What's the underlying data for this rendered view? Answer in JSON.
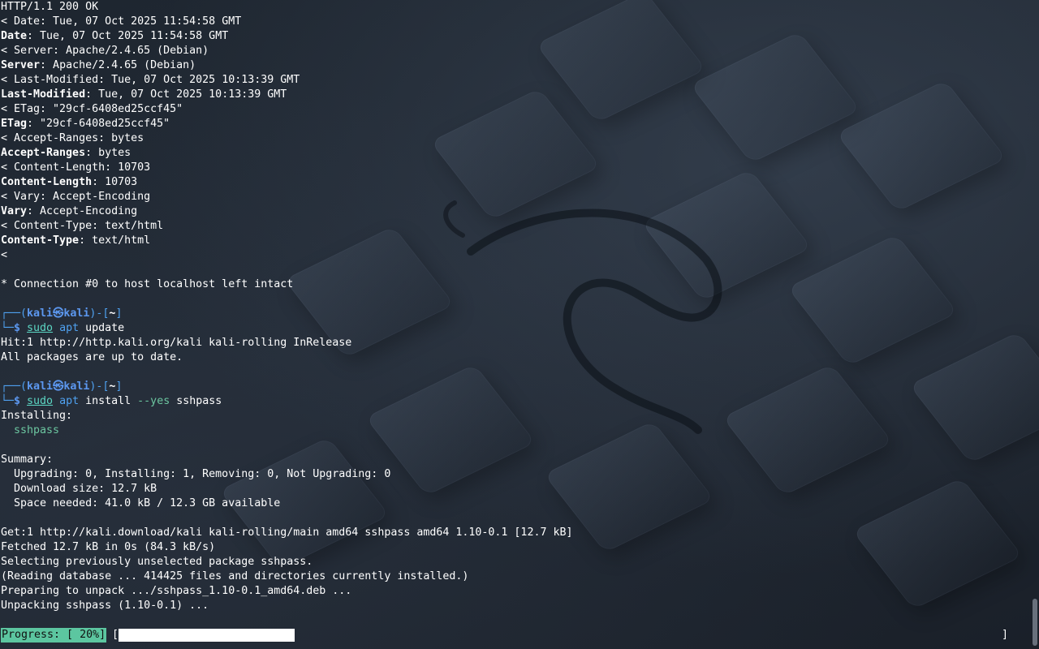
{
  "terminal": {
    "http_header_lines": [
      {
        "prefix": "",
        "key": "",
        "text": "HTTP/1.1 200 OK"
      },
      {
        "prefix": "< ",
        "key": "",
        "text": "Date: Tue, 07 Oct 2025 11:54:58 GMT"
      },
      {
        "prefix": "",
        "key": "Date",
        "text": ": Tue, 07 Oct 2025 11:54:58 GMT"
      },
      {
        "prefix": "< ",
        "key": "",
        "text": "Server: Apache/2.4.65 (Debian)"
      },
      {
        "prefix": "",
        "key": "Server",
        "text": ": Apache/2.4.65 (Debian)"
      },
      {
        "prefix": "< ",
        "key": "",
        "text": "Last-Modified: Tue, 07 Oct 2025 10:13:39 GMT"
      },
      {
        "prefix": "",
        "key": "Last-Modified",
        "text": ": Tue, 07 Oct 2025 10:13:39 GMT"
      },
      {
        "prefix": "< ",
        "key": "",
        "text": "ETag: \"29cf-6408ed25ccf45\""
      },
      {
        "prefix": "",
        "key": "ETag",
        "text": ": \"29cf-6408ed25ccf45\""
      },
      {
        "prefix": "< ",
        "key": "",
        "text": "Accept-Ranges: bytes"
      },
      {
        "prefix": "",
        "key": "Accept-Ranges",
        "text": ": bytes"
      },
      {
        "prefix": "< ",
        "key": "",
        "text": "Content-Length: 10703"
      },
      {
        "prefix": "",
        "key": "Content-Length",
        "text": ": 10703"
      },
      {
        "prefix": "< ",
        "key": "",
        "text": "Vary: Accept-Encoding"
      },
      {
        "prefix": "",
        "key": "Vary",
        "text": ": Accept-Encoding"
      },
      {
        "prefix": "< ",
        "key": "",
        "text": "Content-Type: text/html"
      },
      {
        "prefix": "",
        "key": "Content-Type",
        "text": ": text/html"
      },
      {
        "prefix": "<",
        "key": "",
        "text": ""
      },
      {
        "prefix": "",
        "key": "",
        "text": ""
      },
      {
        "prefix": "",
        "key": "",
        "text": "* Connection #0 to host localhost left intact"
      }
    ],
    "prompt": {
      "top_open": "┌──(",
      "user": "kali",
      "at": "㉿",
      "host": "kali",
      "mid": ")-[",
      "dir": "~",
      "close": "]",
      "bottom": "└─",
      "dollar": "$ "
    },
    "cmd1": {
      "sudo": "sudo",
      "apt": "apt",
      "args": " update"
    },
    "cmd1_output": [
      "Hit:1 http://http.kali.org/kali kali-rolling InRelease",
      "All packages are up to date."
    ],
    "cmd2": {
      "sudo": "sudo",
      "apt": "apt",
      "args_pre": " install ",
      "flag": "--yes",
      "args_post": " sshpass"
    },
    "install_output": {
      "installing_label": "Installing:",
      "package": "  sshpass",
      "summary_label": "Summary:",
      "summary_lines": [
        "  Upgrading: 0, Installing: 1, Removing: 0, Not Upgrading: 0",
        "  Download size: 12.7 kB",
        "  Space needed: 41.0 kB / 12.3 GB available"
      ],
      "progress_lines": [
        "Get:1 http://kali.download/kali kali-rolling/main amd64 sshpass amd64 1.10-0.1 [12.7 kB]",
        "Fetched 12.7 kB in 0s (84.3 kB/s)",
        "Selecting previously unselected package sshpass.",
        "(Reading database ... 414425 files and directories currently installed.)",
        "Preparing to unpack .../sshpass_1.10-0.1_amd64.deb ...",
        "Unpacking sshpass (1.10-0.1) ..."
      ]
    },
    "progress": {
      "label": "Progress: [ 20%]",
      "open_bracket": "[",
      "close_bracket": "]",
      "fraction": 0.2
    }
  },
  "colors": {
    "background": "#1b222c",
    "prompt_blue": "#4fa1f0",
    "command_teal": "#5cd7c4",
    "package_green": "#6cc6a0",
    "progress_bg": "#5cc6a0"
  }
}
